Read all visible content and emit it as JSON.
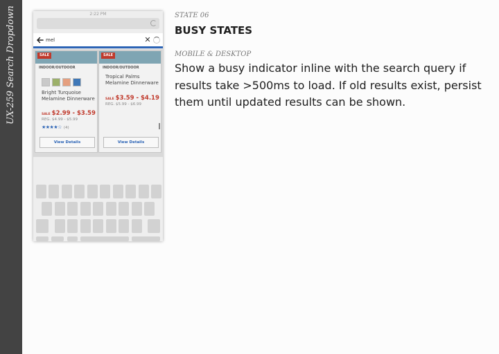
{
  "sidebar": {
    "title": "UX-259 Search Dropdown"
  },
  "mockup": {
    "status_time": "2:22 PM",
    "search_query": "mel",
    "clear_glyph": "✕",
    "accent_color": "#2b63b5",
    "sale_color": "#c0392b",
    "cards": [
      {
        "sale_badge": "SALE",
        "category": "INDOOR/OUTDOOR",
        "swatch_colors": [
          "#c9c9c9",
          "#9cb06a",
          "#e59f7f",
          "#3f78b8"
        ],
        "name": "Bright Turquoise Melamine Dinnerware",
        "price_tag": "SALE",
        "price": "$2.99 - $3.59",
        "reg_price": "REG. $4.99 - $5.99",
        "stars": "★★★★☆",
        "rating_count": "(4)",
        "button_label": "View Details"
      },
      {
        "sale_badge": "SALE",
        "category": "INDOOR/OUTDOOR",
        "name": "Tropical Palms Melamine Dinnerware",
        "price_tag": "SALE",
        "price": "$3.59 - $4.19",
        "reg_price": "REG. $5.99 - $6.99",
        "button_label": "View Details"
      }
    ]
  },
  "content": {
    "state_label": "STATE 06",
    "state_title": "BUSY STATES",
    "platform_label": "MOBILE & DESKTOP",
    "description": "Show a busy indicator inline with the search query if results take >500ms to load. If old results exist, persist them until updated results can be shown."
  }
}
